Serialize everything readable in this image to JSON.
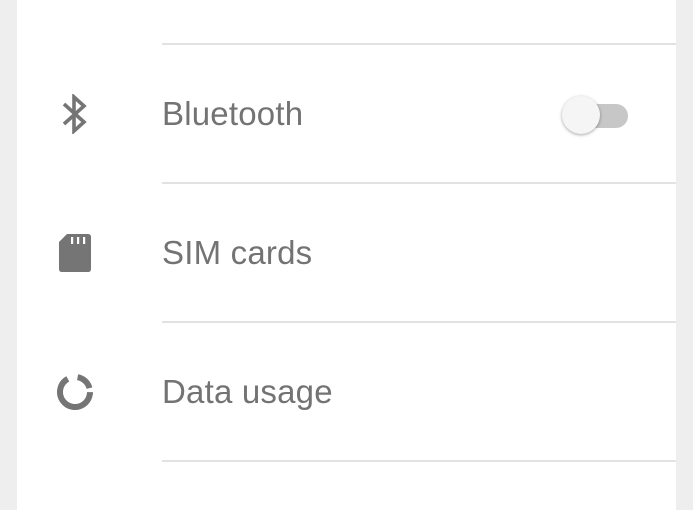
{
  "settings": {
    "items": [
      {
        "label": "Bluetooth",
        "icon": "bluetooth-icon",
        "toggle": {
          "on": false
        }
      },
      {
        "label": "SIM cards",
        "icon": "sim-card-icon"
      },
      {
        "label": "Data usage",
        "icon": "data-usage-icon"
      }
    ]
  },
  "colors": {
    "background": "#eeeeee",
    "card": "#ffffff",
    "icon": "#757575",
    "text": "#737373",
    "divider": "#e2e2e2",
    "toggle_track": "#c7c7c7",
    "toggle_thumb": "#f5f5f5"
  }
}
